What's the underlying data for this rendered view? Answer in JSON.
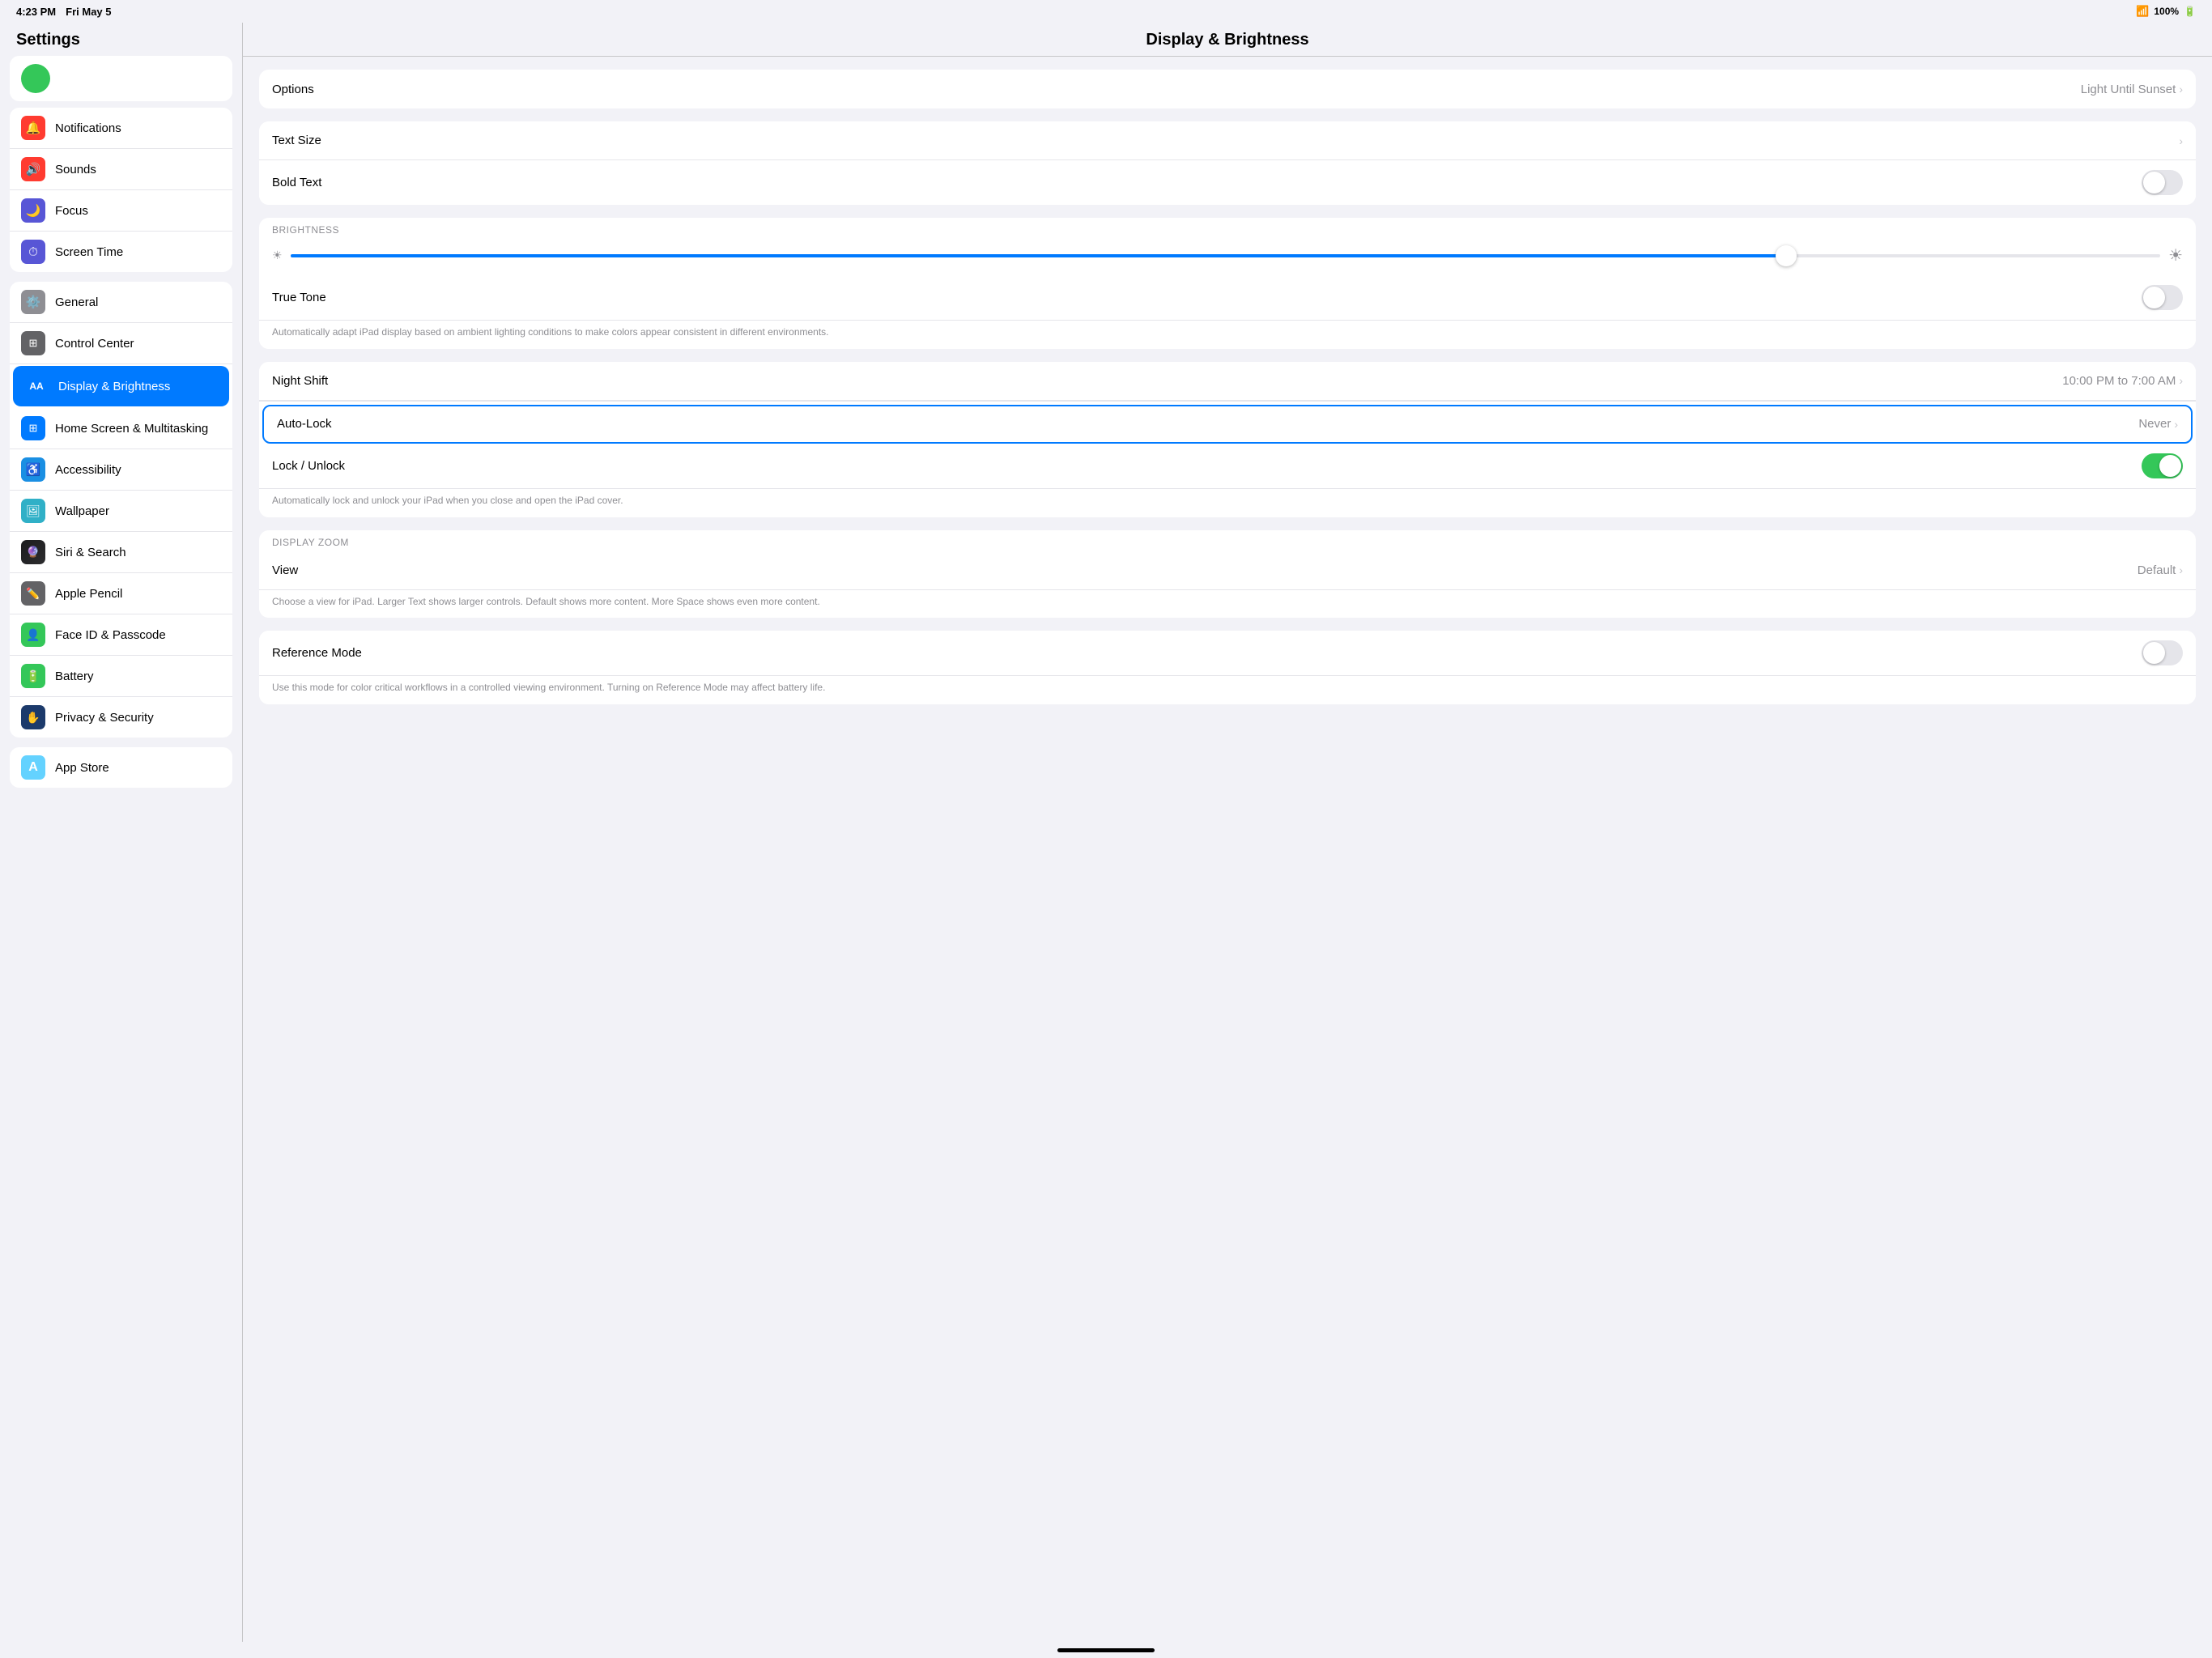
{
  "statusBar": {
    "time": "4:23 PM",
    "date": "Fri May 5",
    "wifi": "WiFi",
    "battery": "100%"
  },
  "sidebar": {
    "title": "Settings",
    "groups": [
      {
        "id": "top-group",
        "items": [
          {
            "id": "notifications",
            "label": "Notifications",
            "iconColor": "icon-red",
            "iconSymbol": "🔔",
            "active": false
          },
          {
            "id": "sounds",
            "label": "Sounds",
            "iconColor": "icon-red",
            "iconSymbol": "🔊",
            "active": false
          },
          {
            "id": "focus",
            "label": "Focus",
            "iconColor": "icon-indigo",
            "iconSymbol": "🌙",
            "active": false
          },
          {
            "id": "screen-time",
            "label": "Screen Time",
            "iconColor": "icon-indigo",
            "iconSymbol": "⏱",
            "active": false
          }
        ]
      },
      {
        "id": "mid-group",
        "items": [
          {
            "id": "general",
            "label": "General",
            "iconColor": "icon-gray",
            "iconSymbol": "⚙️",
            "active": false
          },
          {
            "id": "control-center",
            "label": "Control Center",
            "iconColor": "icon-gray2",
            "iconSymbol": "⊞",
            "active": false
          },
          {
            "id": "display-brightness",
            "label": "Display & Brightness",
            "iconColor": "icon-blue",
            "iconSymbol": "AA",
            "active": true
          },
          {
            "id": "home-screen",
            "label": "Home Screen & Multitasking",
            "iconColor": "icon-blue",
            "iconSymbol": "⊞",
            "active": false
          },
          {
            "id": "accessibility",
            "label": "Accessibility",
            "iconColor": "icon-blue-bright",
            "iconSymbol": "♿",
            "active": false
          },
          {
            "id": "wallpaper",
            "label": "Wallpaper",
            "iconColor": "icon-teal",
            "iconSymbol": "🖼",
            "active": false
          },
          {
            "id": "siri-search",
            "label": "Siri & Search",
            "iconColor": "icon-gray2",
            "iconSymbol": "◉",
            "active": false
          },
          {
            "id": "apple-pencil",
            "label": "Apple Pencil",
            "iconColor": "icon-gray2",
            "iconSymbol": "✏️",
            "active": false
          },
          {
            "id": "face-id",
            "label": "Face ID & Passcode",
            "iconColor": "icon-green",
            "iconSymbol": "👤",
            "active": false
          },
          {
            "id": "battery",
            "label": "Battery",
            "iconColor": "icon-green",
            "iconSymbol": "🔋",
            "active": false
          },
          {
            "id": "privacy-security",
            "label": "Privacy & Security",
            "iconColor": "icon-blue-dark",
            "iconSymbol": "✋",
            "active": false
          }
        ]
      },
      {
        "id": "bottom-group",
        "items": [
          {
            "id": "app-store",
            "label": "App Store",
            "iconColor": "icon-sky",
            "iconSymbol": "A",
            "active": false
          }
        ]
      }
    ]
  },
  "mainContent": {
    "title": "Display & Brightness",
    "sections": [
      {
        "id": "appearance-options",
        "rows": [
          {
            "id": "options",
            "label": "Options",
            "value": "Light Until Sunset",
            "hasChevron": true,
            "type": "nav"
          }
        ]
      },
      {
        "id": "text-section",
        "rows": [
          {
            "id": "text-size",
            "label": "Text Size",
            "value": "",
            "hasChevron": true,
            "type": "nav"
          },
          {
            "id": "bold-text",
            "label": "Bold Text",
            "value": "",
            "hasChevron": false,
            "type": "toggle",
            "toggleState": "off"
          }
        ]
      },
      {
        "id": "brightness-section",
        "sectionLabel": "BRIGHTNESS",
        "sliderPercent": 80,
        "rows": [
          {
            "id": "true-tone",
            "label": "True Tone",
            "value": "",
            "hasChevron": false,
            "type": "toggle",
            "toggleState": "off"
          }
        ],
        "description": "Automatically adapt iPad display based on ambient lighting conditions to make colors appear consistent in different environments."
      },
      {
        "id": "lock-section",
        "rows": [
          {
            "id": "night-shift",
            "label": "Night Shift",
            "value": "10:00 PM to 7:00 AM",
            "hasChevron": true,
            "type": "nav"
          },
          {
            "id": "auto-lock",
            "label": "Auto-Lock",
            "value": "Never",
            "hasChevron": true,
            "type": "nav",
            "highlighted": true
          },
          {
            "id": "lock-unlock",
            "label": "Lock / Unlock",
            "value": "",
            "hasChevron": false,
            "type": "toggle",
            "toggleState": "on"
          }
        ],
        "lockDescription": "Automatically lock and unlock your iPad when you close and open the iPad cover."
      },
      {
        "id": "zoom-section",
        "sectionLabel": "DISPLAY ZOOM",
        "rows": [
          {
            "id": "view",
            "label": "View",
            "value": "Default",
            "hasChevron": true,
            "type": "nav"
          }
        ],
        "viewDescription": "Choose a view for iPad. Larger Text shows larger controls. Default shows more content. More Space shows even more content."
      },
      {
        "id": "reference-section",
        "rows": [
          {
            "id": "reference-mode",
            "label": "Reference Mode",
            "value": "",
            "hasChevron": false,
            "type": "toggle",
            "toggleState": "off"
          }
        ],
        "refDescription": "Use this mode for color critical workflows in a controlled viewing environment. Turning on Reference Mode may affect battery life."
      }
    ]
  }
}
